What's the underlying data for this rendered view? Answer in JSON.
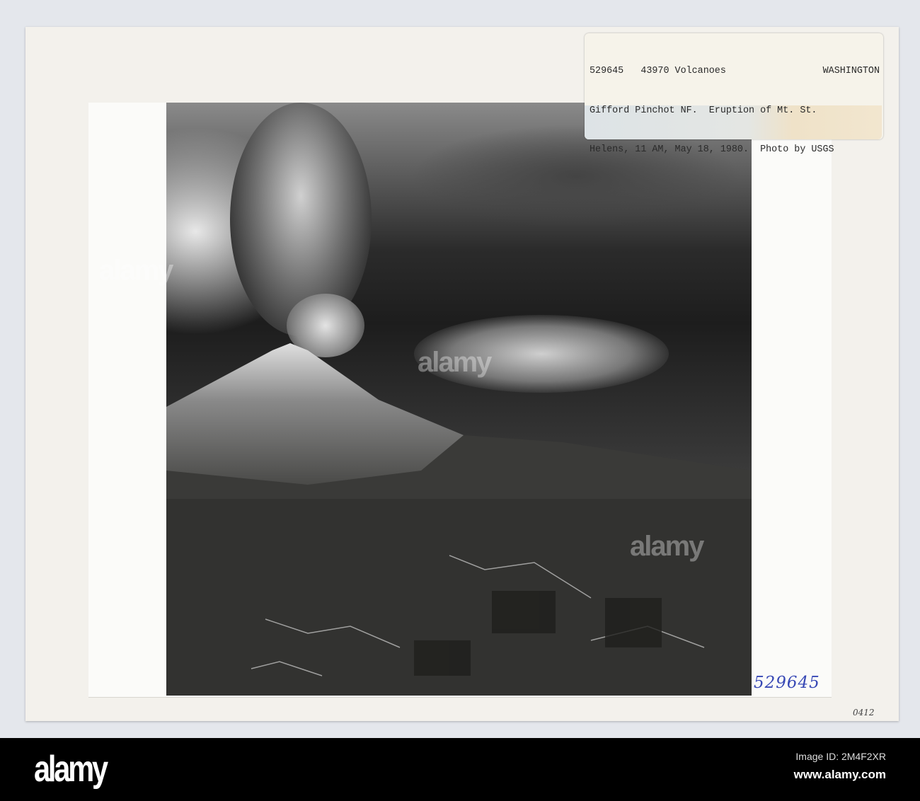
{
  "label": {
    "catalog_number": "529645",
    "series": "43970 Volcanoes",
    "state": "WASHINGTON",
    "line2": "Gifford Pinchot NF.  Eruption of Mt. St.",
    "line3": "Helens, 11 AM, May 18, 1980.  Photo by USGS"
  },
  "handwritten_number": "529645",
  "corner_code": "0412",
  "watermark": {
    "logo": "alamy",
    "image_id": "Image ID: 2M4F2XR",
    "url": "www.alamy.com"
  }
}
